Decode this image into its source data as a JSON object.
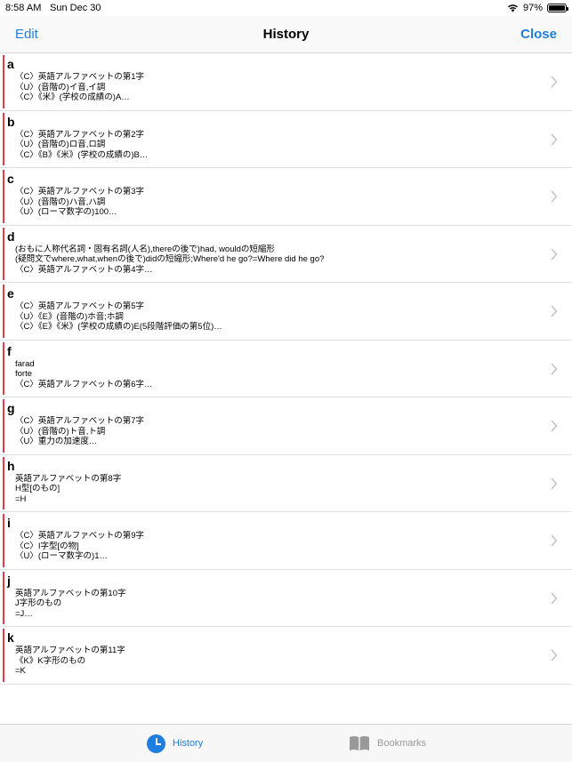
{
  "status": {
    "time": "8:58 AM",
    "date": "Sun Dec 30",
    "battery": "97%"
  },
  "nav": {
    "edit": "Edit",
    "title": "History",
    "close": "Close"
  },
  "rows": [
    {
      "word": "a",
      "lines": [
        "〈C〉英語アルファベットの第1字",
        "〈U〉(音階の)イ音,イ調",
        "〈C〉《米》(学校の成績の)A…"
      ]
    },
    {
      "word": "b",
      "lines": [
        "〈C〉英語アルファベットの第2字",
        "〈U〉(音階の)ロ音,ロ調",
        "〈C〉《B》《米》(学校の成績の)B…"
      ]
    },
    {
      "word": "c",
      "lines": [
        "〈C〉英語アルファベットの第3字",
        "〈U〉(音階の)ハ音,ハ調",
        "〈U〉(ローマ数字の)100…"
      ]
    },
    {
      "word": "d",
      "lines": [
        "(おもに人称代名詞・固有名詞(人名),thereの後で)had, wouldの短縮形",
        "(疑問文でwhere,what,whenの後で)didの短縮形;Where'd he go?=Where did he go?",
        "〈C〉英語アルファベットの第4字…"
      ]
    },
    {
      "word": "e",
      "lines": [
        "〈C〉英語アルファベットの第5字",
        "〈U〉《E》(音階の)ホ音;ホ調",
        "〈C〉《E》《米》(学校の成績の)E(5段階評価の第5位)…"
      ]
    },
    {
      "word": "f",
      "lines": [
        "farad",
        "forte",
        "〈C〉英語アルファベットの第6字…"
      ]
    },
    {
      "word": "g",
      "lines": [
        "〈C〉英語アルファベットの第7字",
        "〈U〉(音階の)ト音,ト調",
        "〈U〉重力の加速度…"
      ]
    },
    {
      "word": "h",
      "lines": [
        "英語アルファベットの第8字",
        "H型[のもの]",
        "=H"
      ]
    },
    {
      "word": "i",
      "lines": [
        "〈C〉英語アルファベットの第9字",
        "〈C〉I字型[の物]",
        "〈U〉(ローマ数字の)1…"
      ]
    },
    {
      "word": "j",
      "lines": [
        "英語アルファベットの第10字",
        "J字形のもの",
        "=J…"
      ]
    },
    {
      "word": "k",
      "lines": [
        "英語アルファベットの第11字",
        "《K》K字形のもの",
        "=K"
      ]
    }
  ],
  "tabs": {
    "history": "History",
    "bookmarks": "Bookmarks"
  },
  "colors": {
    "accent": "#1e7fe0",
    "row_marker": "#e8394a"
  }
}
